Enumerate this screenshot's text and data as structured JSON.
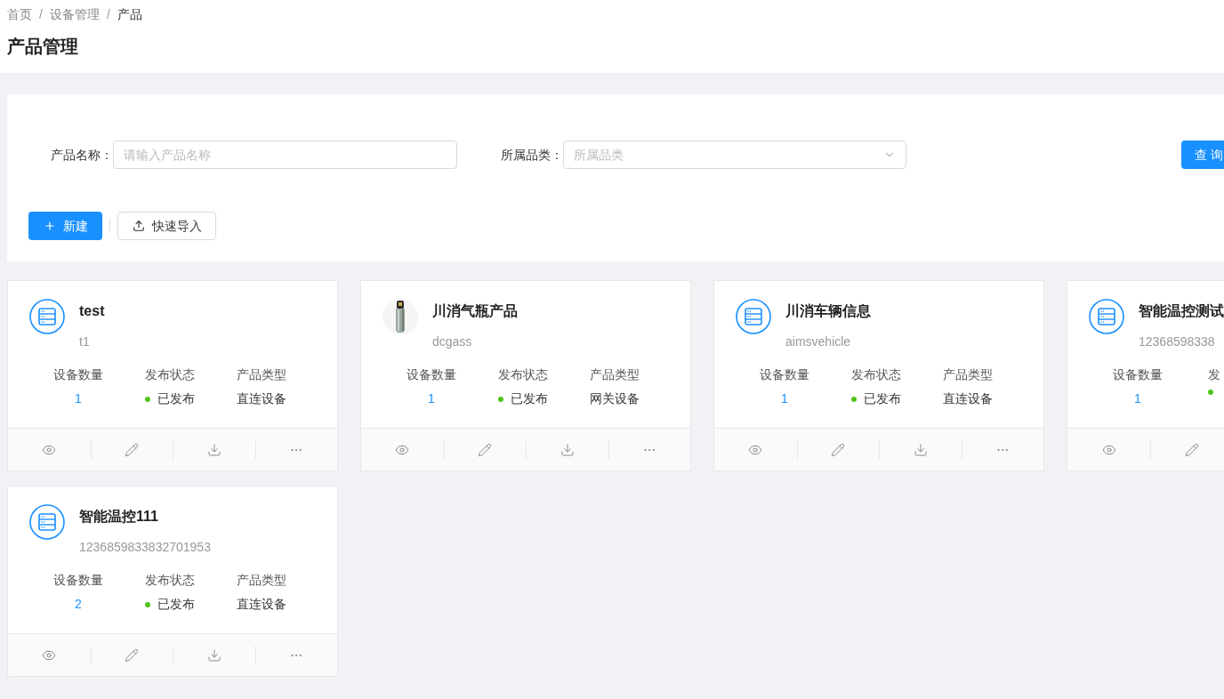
{
  "breadcrumb": [
    "首页",
    "/",
    "设备管理",
    "/",
    "产品"
  ],
  "page_title": "产品管理",
  "search": {
    "fields": [
      {
        "kind": "input",
        "label": "产品名称：",
        "placeholder": "请输入产品名称"
      },
      {
        "kind": "select",
        "label": "所属品类：",
        "placeholder": "所属品类"
      }
    ],
    "query_button": "查 询"
  },
  "toolbar": {
    "new_button": "新建",
    "import_button": "快速导入"
  },
  "products": [
    {
      "kind": "device",
      "name": "test",
      "code": "t1",
      "stats": [
        {
          "kind": "count",
          "label": "设备数量",
          "value": "1"
        },
        {
          "kind": "status",
          "label": "发布状态",
          "value": "已发布",
          "color": "#52c41a"
        },
        {
          "kind": "text",
          "label": "产品类型",
          "value": "直连设备"
        }
      ],
      "actions": [
        {
          "kind": "view"
        },
        {
          "kind": "edit"
        },
        {
          "kind": "download"
        },
        {
          "kind": "more"
        }
      ]
    },
    {
      "kind": "picture",
      "name": "川消气瓶产品",
      "code": "dcgass",
      "stats": [
        {
          "kind": "count",
          "label": "设备数量",
          "value": "1"
        },
        {
          "kind": "status",
          "label": "发布状态",
          "value": "已发布",
          "color": "#52c41a"
        },
        {
          "kind": "text",
          "label": "产品类型",
          "value": "网关设备"
        }
      ],
      "actions": [
        {
          "kind": "view"
        },
        {
          "kind": "edit"
        },
        {
          "kind": "download"
        },
        {
          "kind": "more"
        }
      ]
    },
    {
      "kind": "device",
      "name": "川消车辆信息",
      "code": "aimsvehicle",
      "stats": [
        {
          "kind": "count",
          "label": "设备数量",
          "value": "1"
        },
        {
          "kind": "status",
          "label": "发布状态",
          "value": "已发布",
          "color": "#52c41a"
        },
        {
          "kind": "text",
          "label": "产品类型",
          "value": "直连设备"
        }
      ],
      "actions": [
        {
          "kind": "view"
        },
        {
          "kind": "edit"
        },
        {
          "kind": "download"
        },
        {
          "kind": "more"
        }
      ]
    },
    {
      "kind": "device",
      "name": "智能温控测试",
      "code": "12368598338",
      "stats": [
        {
          "kind": "count",
          "label": "设备数量",
          "value": "1"
        },
        {
          "kind": "status",
          "label": "发",
          "color": "#52c41a"
        }
      ],
      "actions": [
        {
          "kind": "view"
        },
        {
          "kind": "edit"
        }
      ]
    },
    {
      "kind": "device",
      "name": "智能温控111",
      "code": "1236859833832701953",
      "stats": [
        {
          "kind": "count",
          "label": "设备数量",
          "value": "2"
        },
        {
          "kind": "status",
          "label": "发布状态",
          "value": "已发布",
          "color": "#52c41a"
        },
        {
          "kind": "text",
          "label": "产品类型",
          "value": "直连设备"
        }
      ],
      "actions": [
        {
          "kind": "view"
        },
        {
          "kind": "edit"
        },
        {
          "kind": "download"
        },
        {
          "kind": "more"
        }
      ]
    }
  ]
}
